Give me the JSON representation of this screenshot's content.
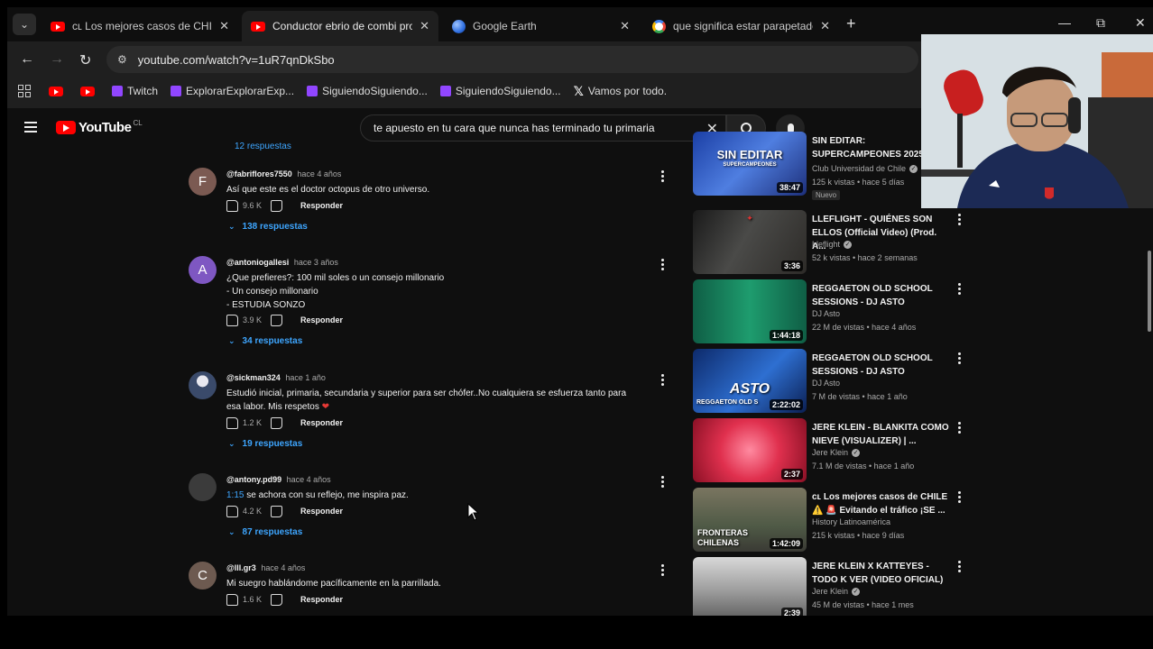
{
  "tabs": [
    {
      "title": "ᴄʟ Los mejores casos de CHILE ⚠️",
      "favicon": "youtube-icon",
      "active": false
    },
    {
      "title": "Conductor ebrio de combi provoca",
      "favicon": "youtube-icon",
      "active": true
    },
    {
      "title": "Google Earth",
      "favicon": "google-earth-icon",
      "active": false
    },
    {
      "title": "que significa estar parapetado",
      "favicon": "google-icon",
      "active": false
    }
  ],
  "address_bar": {
    "url": "youtube.com/watch?v=1uR7qnDkSbo"
  },
  "bookmarks": [
    {
      "label": "",
      "icon": "youtube-icon"
    },
    {
      "label": "",
      "icon": "youtube-icon"
    },
    {
      "label": "Twitch",
      "icon": "twitch-icon"
    },
    {
      "label": "ExplorarExplorarExp...",
      "icon": "twitch-icon"
    },
    {
      "label": "SiguiendoSiguiendo...",
      "icon": "twitch-icon"
    },
    {
      "label": "SiguiendoSiguiendo...",
      "icon": "twitch-icon"
    },
    {
      "label": "Vamos por todo.",
      "icon": "x-icon"
    }
  ],
  "youtube": {
    "logo_text": "YouTube",
    "country_code": "CL",
    "search_query": "te apuesto en tu cara que nunca has terminado tu primaria"
  },
  "comments": {
    "top_replies_label": "12 respuestas",
    "reply_label": "Responder",
    "items": [
      {
        "author": "@fabriflores7550",
        "time": "hace 4 años",
        "avatar_letter": "F",
        "avatar_color": "#7b5a52",
        "lines": [
          "Así que este es el doctor octopus de otro universo."
        ],
        "likes": "9.6 K",
        "replies": "138 respuestas"
      },
      {
        "author": "@antoniogallesi",
        "time": "hace 3 años",
        "avatar_letter": "A",
        "avatar_color": "#7e57c2",
        "lines": [
          "¿Que prefieres?: 100 mil soles o un consejo millonario",
          "- Un consejo millonario",
          "- ESTUDIA SONZO"
        ],
        "likes": "3.9 K",
        "replies": "34 respuestas"
      },
      {
        "author": "@sickman324",
        "time": "hace 1 año",
        "avatar_letter": "",
        "avatar_color": "#3a4a6a",
        "lines": [
          "Estudió inicial, primaria, secundaria y superior para ser chófer..No cualquiera se esfuerza tanto para",
          "esa labor. Mis respetos"
        ],
        "likes": "1.2 K",
        "replies": "19 respuestas"
      },
      {
        "author": "@antony.pd99",
        "time": "hace 4 años",
        "avatar_letter": "",
        "avatar_color": "#3b3b3b",
        "timestamp": "1:15",
        "lines": [
          "se achora con su reflejo, me inspira paz."
        ],
        "likes": "4.2 K",
        "replies": "87 respuestas"
      },
      {
        "author": "@lll.gr3",
        "time": "hace 4 años",
        "avatar_letter": "C",
        "avatar_color": "#6d5a50",
        "lines": [
          "Mi suegro hablándome pacíficamente en la parrillada."
        ],
        "likes": "1.6 K",
        "replies": ""
      }
    ]
  },
  "recommendations": [
    {
      "title_lines": [
        "SIN EDITAR:",
        "SUPERCAMPEONES 2025"
      ],
      "channel": "Club Universidad de Chile",
      "verified": true,
      "meta": "125 k vistas • hace 5 días",
      "badge": "Nuevo",
      "duration": "38:47",
      "thumb_text": "SIN EDITAR",
      "thumb_sub": "SUPERCAMPEONES"
    },
    {
      "title_lines": [
        "LLEFLIGHT - QUIÉNES SON",
        "ELLOS (Official Video) (Prod. A..."
      ],
      "channel": "Lleflight",
      "verified": true,
      "meta": "52 k vistas • hace 2 semanas",
      "badge": "",
      "duration": "3:36",
      "thumb_text": "",
      "thumb_sub": ""
    },
    {
      "title_lines": [
        "REGGAETON OLD SCHOOL",
        "SESSIONS - DJ ASTO"
      ],
      "channel": "DJ Asto",
      "verified": false,
      "meta": "22 M de vistas • hace 4 años",
      "badge": "",
      "duration": "1:44:18",
      "thumb_text": "",
      "thumb_sub": ""
    },
    {
      "title_lines": [
        "REGGAETON OLD SCHOOL",
        "SESSIONS - DJ ASTO"
      ],
      "channel": "DJ Asto",
      "verified": false,
      "meta": "7 M de vistas • hace 1 año",
      "badge": "",
      "duration": "2:22:02",
      "thumb_text": "ASTO",
      "thumb_sub": "REGGAETON OLD S"
    },
    {
      "title_lines": [
        "JERE KLEIN - BLANKITA COMO",
        "NIEVE (VISUALIZER) | ..."
      ],
      "channel": "Jere Klein",
      "verified": true,
      "meta": "7.1 M de vistas • hace 1 año",
      "badge": "",
      "duration": "2:37",
      "thumb_text": "",
      "thumb_sub": ""
    },
    {
      "title_lines": [
        "ᴄʟ Los mejores casos de CHILE",
        "⚠️ 🚨 Evitando el tráfico ¡SE ..."
      ],
      "channel": "History Latinoamérica",
      "verified": false,
      "meta": "215 k vistas • hace 9 días",
      "badge": "",
      "duration": "1:42:09",
      "thumb_text": "FRONTERAS",
      "thumb_sub": "CHILENAS"
    },
    {
      "title_lines": [
        "JERE KLEIN X KATTEYES -",
        "TODO K VER (VIDEO OFICIAL)"
      ],
      "channel": "Jere Klein",
      "verified": true,
      "meta": "45 M de vistas • hace 1 mes",
      "badge": "",
      "duration": "2:39",
      "thumb_text": "",
      "thumb_sub": ""
    }
  ],
  "colors": {
    "link_blue": "#3ea6ff",
    "youtube_red": "#ff0000",
    "page_bg": "#0f0f0f"
  }
}
